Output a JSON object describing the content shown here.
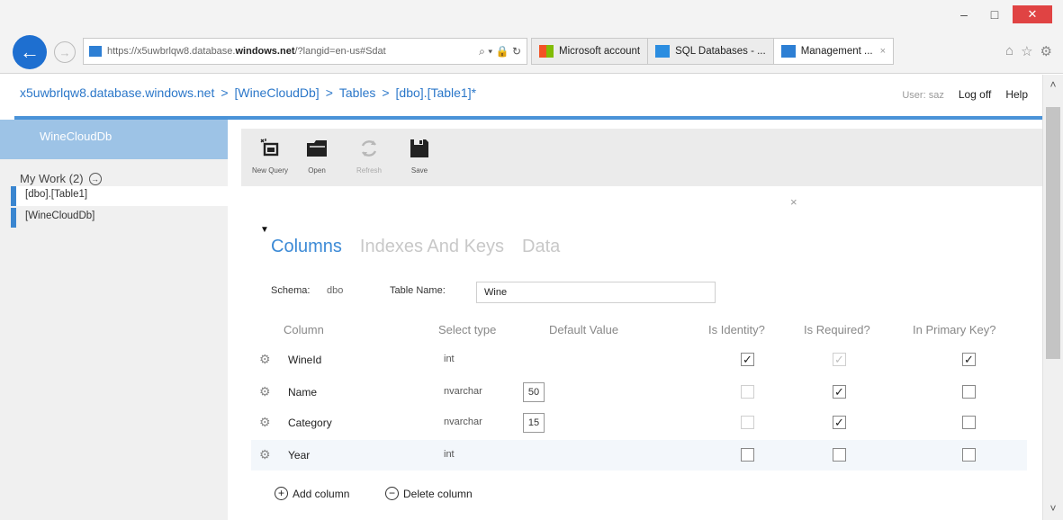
{
  "browser": {
    "url_prefix": "https://x5uwbrlqw8.database.",
    "url_host": "windows.net",
    "url_rest": "/?langid=en-us#Sdat",
    "tabs": [
      {
        "label": "Microsoft account"
      },
      {
        "label": "SQL Databases - ..."
      },
      {
        "label": "Management ...",
        "close": "×"
      }
    ],
    "window_controls": {
      "minimize": "–",
      "maximize": "□",
      "close": "✕"
    }
  },
  "header": {
    "breadcrumb": [
      "x5uwbrlqw8.database.windows.net",
      "[WineCloudDb]",
      "Tables",
      "[dbo].[Table1]*"
    ],
    "separator": ">",
    "user_text": "User: saz",
    "logoff": "Log off",
    "help": "Help"
  },
  "sidebar": {
    "db_title": "WineCloudDb",
    "my_work": "My Work (2)",
    "items": [
      {
        "label": "[dbo].[Table1]"
      },
      {
        "label": "[WineCloudDb]"
      }
    ]
  },
  "toolbar": {
    "new_query": "New Query",
    "open": "Open",
    "refresh": "Refresh",
    "save": "Save",
    "close": "×"
  },
  "designer": {
    "tabs": [
      "Columns",
      "Indexes And Keys",
      "Data"
    ],
    "schema_label": "Schema:",
    "schema_value": "dbo",
    "table_name_label": "Table Name:",
    "table_name_value": "Wine",
    "headers": {
      "column": "Column",
      "select_type": "Select type",
      "default_value": "Default Value",
      "is_identity": "Is Identity?",
      "is_required": "Is Required?",
      "in_primary_key": "In Primary Key?"
    },
    "rows": [
      {
        "name": "WineId",
        "type": "int",
        "length": "",
        "identity": true,
        "required": true,
        "primary": true
      },
      {
        "name": "Name",
        "type": "nvarchar",
        "length": "50",
        "identity": false,
        "required": true,
        "primary": false
      },
      {
        "name": "Category",
        "type": "nvarchar",
        "length": "15",
        "identity": false,
        "required": true,
        "primary": false
      },
      {
        "name": "Year",
        "type": "int",
        "length": "",
        "identity": false,
        "required": false,
        "primary": false
      }
    ],
    "add_column": "Add column",
    "delete_column": "Delete column"
  },
  "colors": {
    "accent": "#3c8ad6",
    "sidebar_title_bg": "#9dc3e6",
    "back_button": "#1e6fd0",
    "close_button": "#e04343"
  }
}
